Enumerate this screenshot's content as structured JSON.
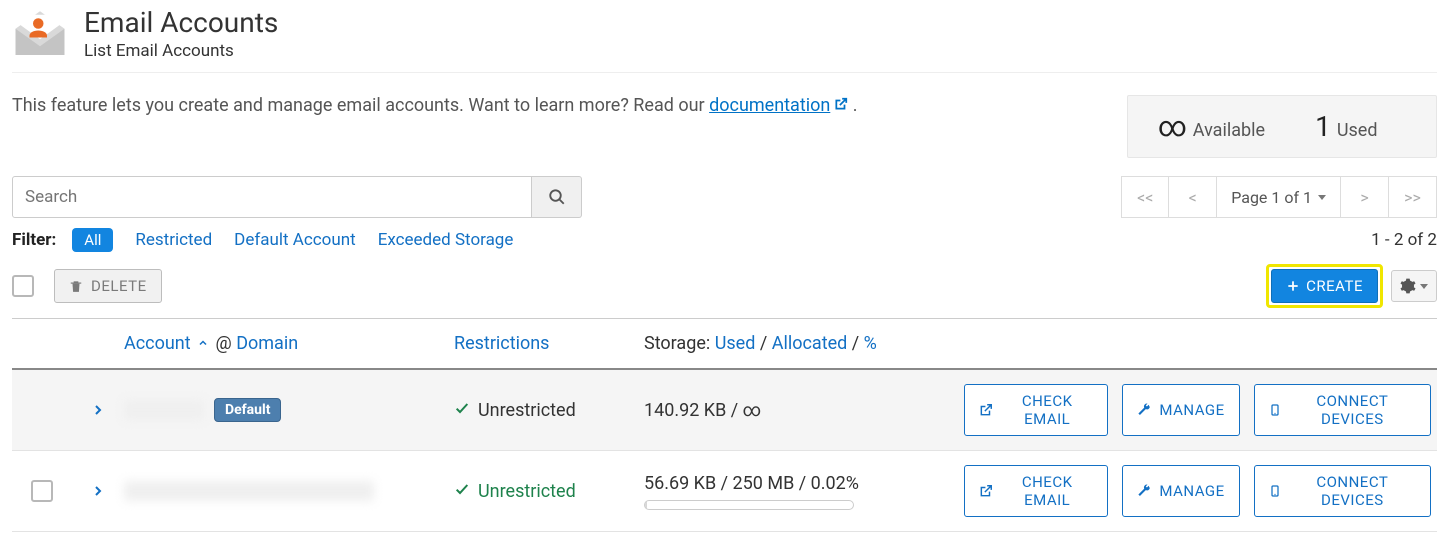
{
  "header": {
    "title": "Email Accounts",
    "subtitle": "List Email Accounts"
  },
  "description": {
    "prefix": "This feature lets you create and manage email accounts. Want to learn more? Read our ",
    "link_text": "documentation",
    "suffix": " ."
  },
  "stats": {
    "available_value": "∞",
    "available_label": "Available",
    "used_value": "1",
    "used_label": "Used"
  },
  "search": {
    "placeholder": "Search"
  },
  "pagination": {
    "first": "<<",
    "prev": "<",
    "page_info": "Page 1 of 1",
    "next": ">",
    "last": ">>"
  },
  "filter": {
    "label": "Filter:",
    "all": "All",
    "restricted": "Restricted",
    "default_account": "Default Account",
    "exceeded": "Exceeded Storage",
    "range": "1 - 2 of 2"
  },
  "bulk": {
    "delete": "DELETE",
    "create": "CREATE"
  },
  "columns": {
    "account": "Account",
    "at": "@",
    "domain": "Domain",
    "restrictions": "Restrictions",
    "storage_prefix": "Storage:",
    "used": "Used",
    "allocated": "Allocated",
    "percent": "%"
  },
  "rows": [
    {
      "badge": "Default",
      "restriction_text": "Unrestricted",
      "restriction_link": false,
      "storage_text": "140.92 KB / ∞",
      "has_progress": false,
      "has_checkbox": false,
      "blur_class": "short"
    },
    {
      "badge": "",
      "restriction_text": "Unrestricted",
      "restriction_link": true,
      "storage_text": "56.69 KB / 250 MB / 0.02%",
      "has_progress": true,
      "has_checkbox": true,
      "blur_class": "long"
    }
  ],
  "actions": {
    "check_email": "CHECK EMAIL",
    "manage": "MANAGE",
    "connect": "CONNECT DEVICES"
  }
}
